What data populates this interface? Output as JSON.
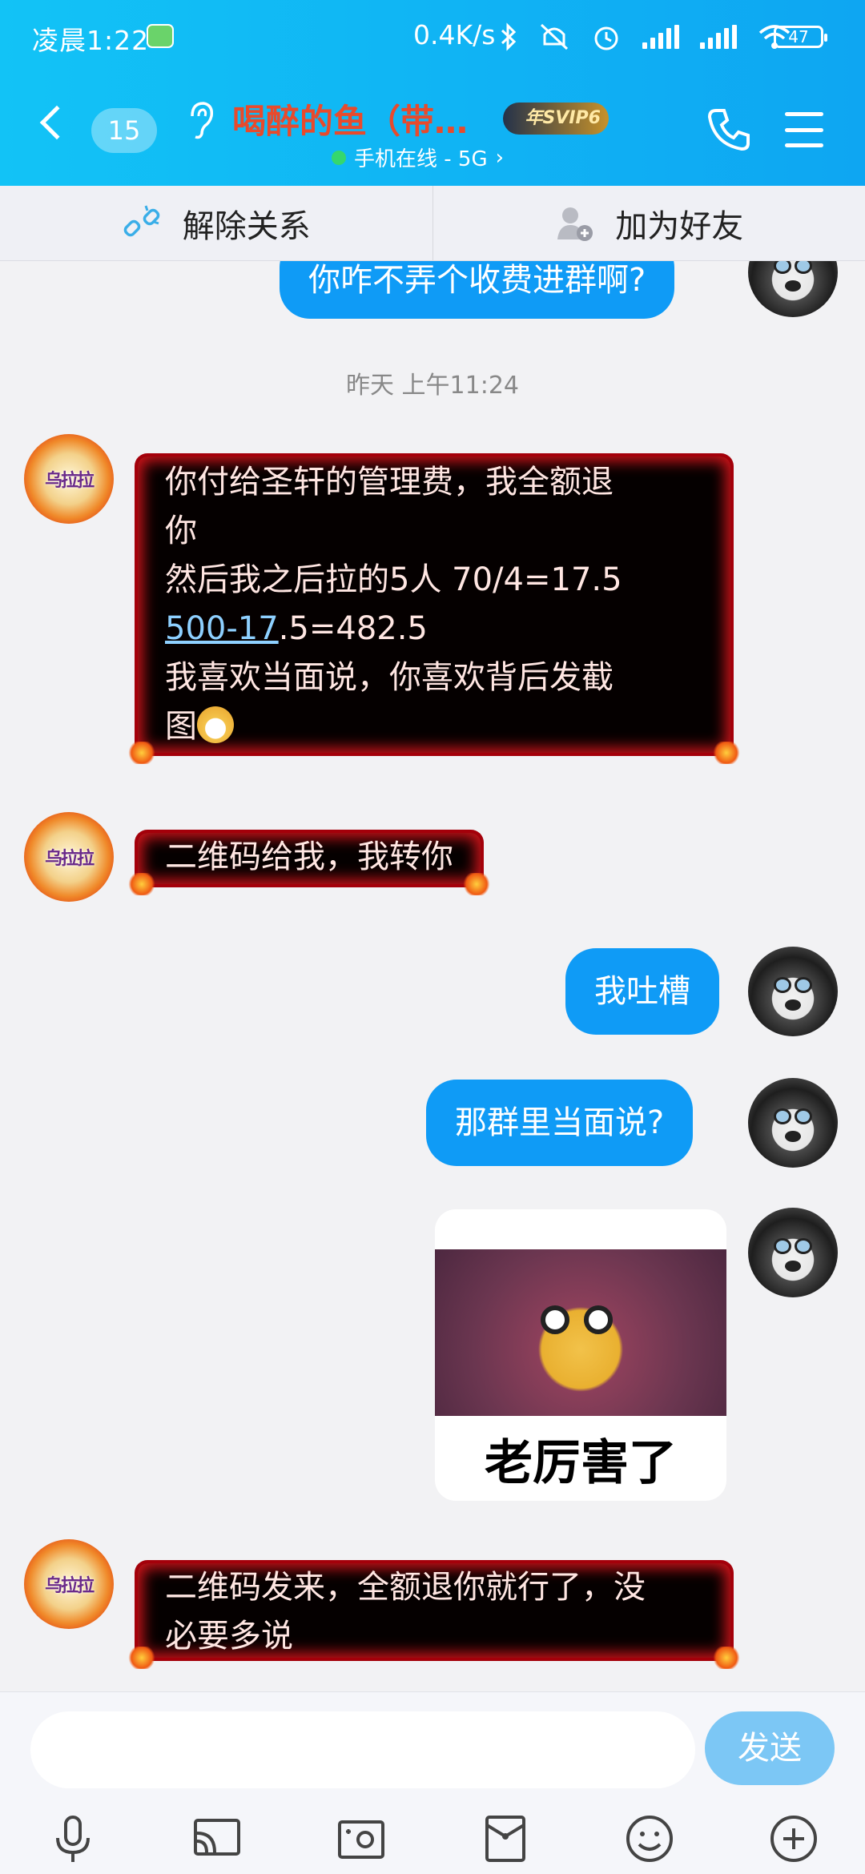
{
  "status_bar": {
    "time": "凌晨1:22",
    "speed": "0.4K/s",
    "battery": "47"
  },
  "header": {
    "unread_count": "15",
    "title": "喝醉的鱼（带…",
    "badge": "年SVIP6",
    "online_status": "手机在线 - 5G",
    "accent_color": "#e84a2c"
  },
  "actions": {
    "unbind_label": "解除关系",
    "add_friend_label": "加为好友"
  },
  "chat": {
    "top_partial": "你咋不弄个收费进群啊?",
    "timestamp": "昨天 上午11:24",
    "msg1": {
      "line1": "你付给圣轩的管理费，我全额退",
      "line2": "你",
      "line3": "然后我之后拉的5人 70/4=17.5",
      "line4_link": "500-17",
      "line4_rest": ".5=482.5",
      "line5": "我喜欢当面说，你喜欢背后发截",
      "line6": "图"
    },
    "msg2": "二维码给我，我转你",
    "msg3": "我吐槽",
    "msg4": "那群里当面说?",
    "sticker_caption": "老厉害了",
    "msg5_line1": "二维码发来，全额退你就行了，没",
    "msg5_line2": "必要多说",
    "avatar_text": "乌拉拉"
  },
  "input": {
    "send_label": "发送"
  },
  "icons": [
    "back-icon",
    "ear-icon",
    "phone-icon",
    "menu-icon",
    "unlink-icon",
    "add-friend-icon",
    "mic-icon",
    "screen-share-icon",
    "photo-icon",
    "red-packet-icon",
    "emoji-icon",
    "plus-icon"
  ]
}
